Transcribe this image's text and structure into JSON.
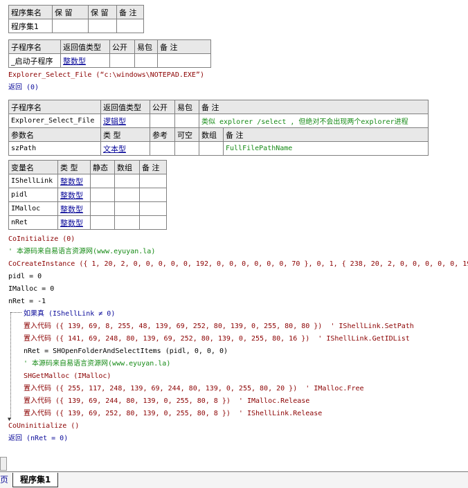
{
  "assembly_table": {
    "headers": [
      "程序集名",
      "保 留",
      "保 留",
      "备 注"
    ],
    "row": [
      "程序集1",
      "",
      "",
      ""
    ]
  },
  "start_sub_table": {
    "headers": [
      "子程序名",
      "返回值类型",
      "公开",
      "易包",
      "备 注"
    ],
    "row": [
      "_启动子程序",
      "整数型",
      "",
      "",
      ""
    ]
  },
  "start_code": [
    "Explorer_Select_File (“c:\\windows\\NOTEPAD.EXE”)",
    "返回 (0)"
  ],
  "func_table": {
    "headers": [
      "子程序名",
      "返回值类型",
      "公开",
      "易包",
      "备 注"
    ],
    "row": [
      "Explorer_Select_File",
      "逻辑型",
      "",
      "",
      "类似 explorer /select , 但绝对不会出现两个explorer进程"
    ],
    "param_headers": [
      "参数名",
      "类 型",
      "参考",
      "可空",
      "数组",
      "备 注"
    ],
    "param_row": [
      "szPath",
      "文本型",
      "",
      "",
      "",
      "FullFilePathName"
    ]
  },
  "var_table": {
    "headers": [
      "变量名",
      "类 型",
      "静态",
      "数组",
      "备 注"
    ],
    "rows": [
      [
        "IShellLink",
        "整数型"
      ],
      [
        "pidl",
        "整数型"
      ],
      [
        "IMalloc",
        "整数型"
      ],
      [
        "nRet",
        "整数型"
      ]
    ]
  },
  "code_lines": [
    "CoInitialize (0)",
    "' 本源码来自易语言资源网(www.eyuyan.la)",
    "CoCreateInstance ({ 1, 20, 2, 0, 0, 0, 0, 0, 192, 0, 0, 0, 0, 0, 0, 70 }, 0, 1, { 238, 20, 2, 0, 0, 0, 0, 0, 19",
    "pidl = 0",
    "IMalloc = 0",
    "nRet = -1",
    "如果真 (IShellLink ≠ 0)",
    "置入代码 ({ 139, 69, 8, 255, 48, 139, 69, 252, 80, 139, 0, 255, 80, 80 })  ' IShellLink.SetPath",
    "置入代码 ({ 141, 69, 248, 80, 139, 69, 252, 80, 139, 0, 255, 80, 16 })  ' IShellLink.GetIDList",
    "nRet = SHOpenFolderAndSelectItems (pidl, 0, 0, 0)",
    "' 本源码来自易语言资源网(www.eyuyan.la)",
    "SHGetMalloc (IMalloc)",
    "置入代码 ({ 255, 117, 248, 139, 69, 244, 80, 139, 0, 255, 80, 20 })  ' IMalloc.Free",
    "置入代码 ({ 139, 69, 244, 80, 139, 0, 255, 80, 8 })  ' IMalloc.Release",
    "置入代码 ({ 139, 69, 252, 80, 139, 0, 255, 80, 8 })  ' IShellLink.Release",
    "CoUninitialize ()",
    "返回 (nRet = 0)"
  ],
  "tabs": [
    "页",
    "程序集1"
  ]
}
